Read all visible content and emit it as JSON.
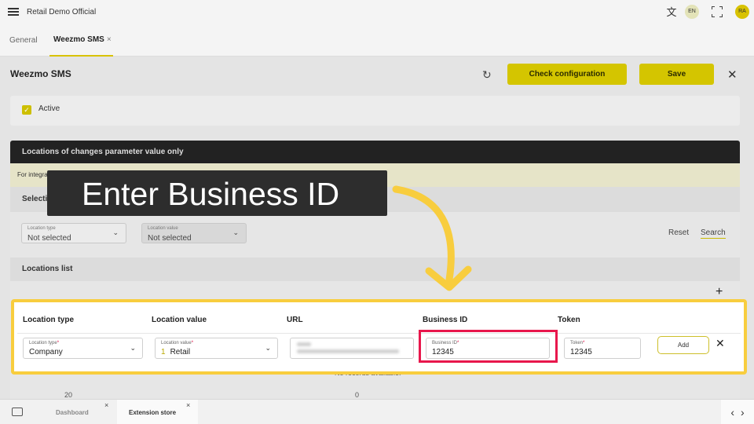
{
  "app": {
    "title": "Retail Demo Official",
    "language": "EN",
    "user_initials": "RA"
  },
  "tabs": [
    {
      "label": "General"
    },
    {
      "label": "Weezmo SMS",
      "close": "×"
    }
  ],
  "page": {
    "title": "Weezmo SMS",
    "check_configuration_label": "Check configuration",
    "save_label": "Save",
    "active_label": "Active",
    "locations_section_title": "Locations of changes parameter value only",
    "info_text": "For integration add locations, please",
    "selection_criteria_title": "Selection Criteria",
    "filters": {
      "location_type": {
        "label": "Location type",
        "value": "Not selected"
      },
      "location_value": {
        "label": "Location value",
        "value": "Not selected"
      }
    },
    "reset_label": "Reset",
    "search_label": "Search",
    "locations_list_title": "Locations list",
    "no_records": "No records available.",
    "pager_fragments": [
      "20",
      "0"
    ]
  },
  "table": {
    "columns": [
      "Location type",
      "Location value",
      "URL",
      "Business ID",
      "Token"
    ],
    "row": {
      "location_type": {
        "label": "Location type",
        "required": "*",
        "value": "Company"
      },
      "location_value": {
        "label": "Location value",
        "required": "*",
        "number": "1",
        "value": "Retail"
      },
      "business_id": {
        "label": "Business ID",
        "required": "*",
        "value": "12345"
      },
      "token": {
        "label": "Token",
        "required": "*",
        "value": "12345"
      },
      "add_label": "Add"
    }
  },
  "taskbar": {
    "tabs": [
      {
        "label": "Dashboard",
        "close": "×"
      },
      {
        "label": "Extension store",
        "close": "×"
      }
    ]
  },
  "overlay": {
    "text": "Enter Business ID",
    "highlight_color": "#e8174c",
    "panel_border_color": "#f8cd3e",
    "arrow_color": "#f8cd3e"
  },
  "colors": {
    "accent_yellow": "#d4c500",
    "dark_header": "#222222"
  }
}
